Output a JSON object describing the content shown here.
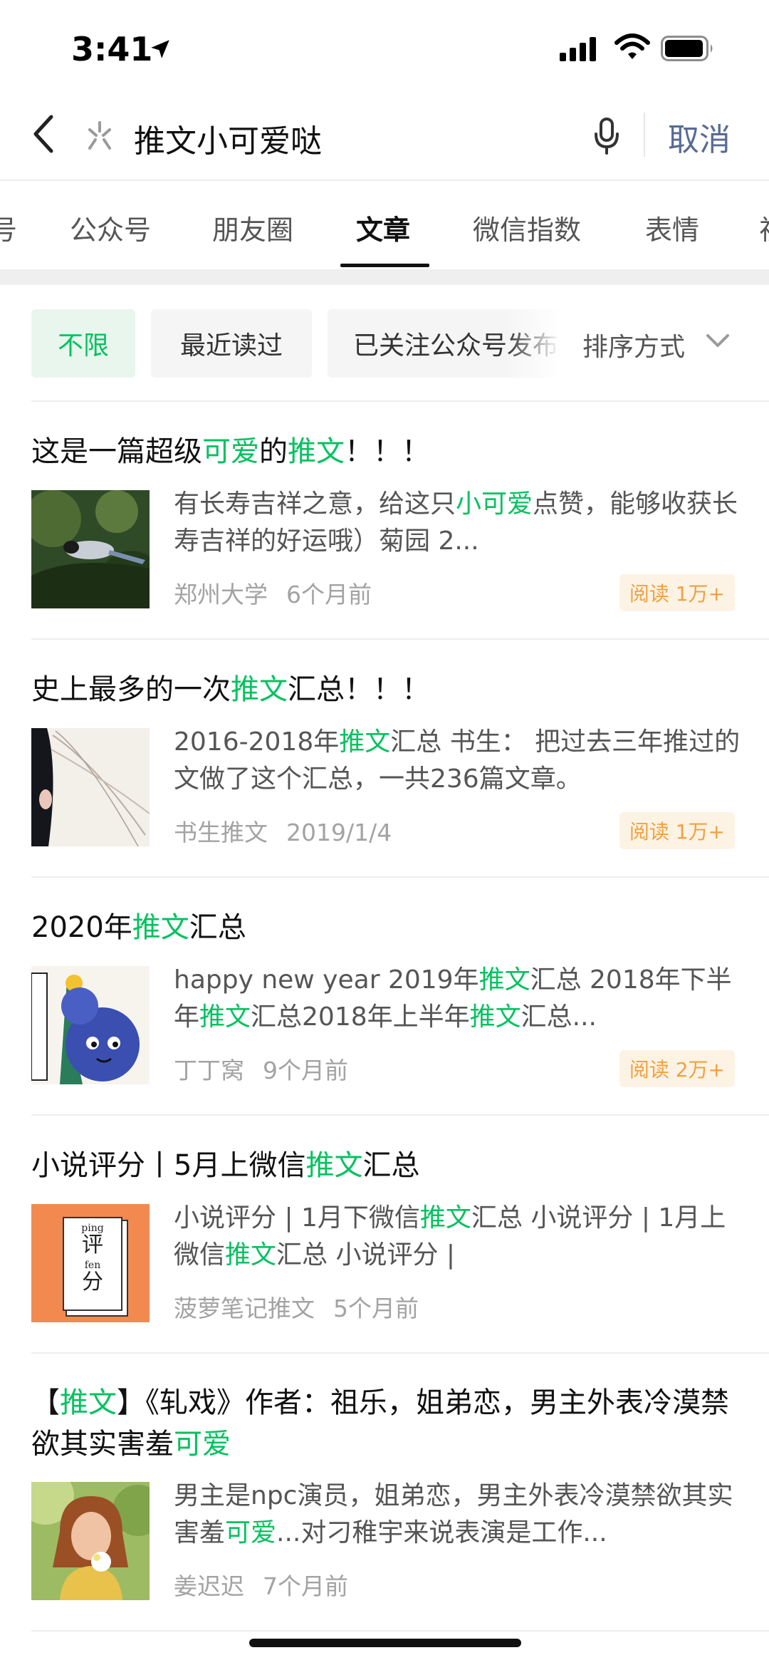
{
  "status_bar": {
    "time": "3:41"
  },
  "search": {
    "query": "推文小可爱哒",
    "cancel_label": "取消"
  },
  "tabs": [
    {
      "label": "号",
      "active": false
    },
    {
      "label": "公众号",
      "active": false
    },
    {
      "label": "朋友圈",
      "active": false
    },
    {
      "label": "文章",
      "active": true
    },
    {
      "label": "微信指数",
      "active": false
    },
    {
      "label": "表情",
      "active": false
    },
    {
      "label": "视",
      "active": false
    }
  ],
  "filters": {
    "chips": [
      {
        "label": "不限",
        "selected": true
      },
      {
        "label": "最近读过",
        "selected": false
      },
      {
        "label": "已关注公众号发布",
        "selected": false
      }
    ],
    "sort_label": "排序方式"
  },
  "articles": [
    {
      "title": [
        [
          "这是一篇超级",
          0
        ],
        [
          "可爱",
          1
        ],
        [
          "的",
          0
        ],
        [
          "推文",
          1
        ],
        [
          "！！！",
          0
        ]
      ],
      "snippet": [
        [
          "有长寿吉祥之意，给这只",
          0
        ],
        [
          "小可爱",
          1
        ],
        [
          "点赞，能够收获长寿吉祥的好运哦）菊园 2...",
          0
        ]
      ],
      "source": "郑州大学",
      "time": "6个月前",
      "reads": "阅读 1万+"
    },
    {
      "title": [
        [
          "史上最多的一次",
          0
        ],
        [
          "推文",
          1
        ],
        [
          "汇总！！！",
          0
        ]
      ],
      "snippet": [
        [
          "2016-2018年",
          0
        ],
        [
          "推文",
          1
        ],
        [
          "汇总 书生： 把过去三年推过的文做了这个汇总，一共236篇文章。",
          0
        ]
      ],
      "source": "书生推文",
      "time": "2019/1/4",
      "reads": "阅读 1万+"
    },
    {
      "title": [
        [
          "2020年",
          0
        ],
        [
          "推文",
          1
        ],
        [
          "汇总",
          0
        ]
      ],
      "snippet": [
        [
          "happy new year 2019年",
          0
        ],
        [
          "推文",
          1
        ],
        [
          "汇总 2018年下半年",
          0
        ],
        [
          "推文",
          1
        ],
        [
          "汇总2018年上半年",
          0
        ],
        [
          "推文",
          1
        ],
        [
          "汇总...",
          0
        ]
      ],
      "source": "丁丁窝",
      "time": "9个月前",
      "reads": "阅读 2万+"
    },
    {
      "title": [
        [
          "小说评分丨5月上微信",
          0
        ],
        [
          "推文",
          1
        ],
        [
          "汇总",
          0
        ]
      ],
      "snippet": [
        [
          "小说评分 | 1月下微信",
          0
        ],
        [
          "推文",
          1
        ],
        [
          "汇总 小说评分 | 1月上微信",
          0
        ],
        [
          "推文",
          1
        ],
        [
          "汇总 小说评分 |",
          0
        ]
      ],
      "source": "菠萝笔记推文",
      "time": "5个月前",
      "reads": ""
    },
    {
      "title": [
        [
          "【",
          0
        ],
        [
          "推文",
          1
        ],
        [
          "】《轧戏》作者：祖乐，姐弟恋，男主外表冷漠禁欲其实害羞",
          0
        ],
        [
          "可爱",
          1
        ]
      ],
      "snippet": [
        [
          "男主是npc演员，姐弟恋，男主外表冷漠禁欲其实害羞",
          0
        ],
        [
          "可爱",
          1
        ],
        [
          "...对刁稚宇来说表演是工作...",
          0
        ]
      ],
      "source": "姜迟迟",
      "time": "7个月前",
      "reads": ""
    }
  ],
  "thumb_text": {
    "ping": "ping",
    "ping_char": "评",
    "fen": "fen",
    "fen_char": "分"
  },
  "colors": {
    "highlight": "#07c160",
    "link": "#576b95",
    "badge_text": "#f0a040",
    "badge_bg": "#fdf3e4"
  }
}
